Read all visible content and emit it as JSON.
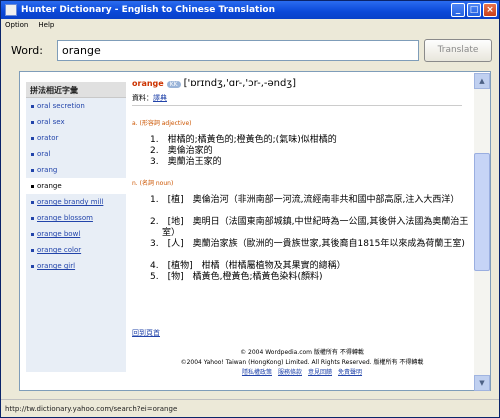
{
  "window": {
    "title": "Hunter Dictionary - English to Chinese Translation",
    "buttons": {
      "minimize": "_",
      "maximize": "□",
      "close": "×"
    }
  },
  "menu": [
    "Option",
    "Help"
  ],
  "search": {
    "label": "Word:",
    "value": "orange",
    "button": "Translate"
  },
  "sidebar": {
    "header": "拼法相近字彙",
    "items": [
      {
        "label": "oral secretion",
        "selected": false
      },
      {
        "label": "oral sex",
        "selected": false
      },
      {
        "label": "orator",
        "selected": false
      },
      {
        "label": "oral",
        "selected": false
      },
      {
        "label": "orang",
        "selected": false
      },
      {
        "label": "orange",
        "selected": true
      },
      {
        "label": "orange brandy mill",
        "selected": false
      },
      {
        "label": "orange blossom",
        "selected": false
      },
      {
        "label": "orange bowl",
        "selected": false
      },
      {
        "label": "orange color",
        "selected": false
      },
      {
        "label": "orange girl",
        "selected": false
      }
    ]
  },
  "entry": {
    "word": "orange",
    "badge": "KK",
    "ipa": "['ɒrɪndʒ,'ɑr-,'ɔr-,-əndʒ]",
    "source_label": "資料：",
    "source_link": "譯典",
    "adj_label": "a. (形容詞 adjective)",
    "adj_defs": [
      "1.　柑橘的;橘黃色的;橙黃色的;(氣味)似柑橘的",
      "2.　奧倫治家的",
      "3.　奧蘭治王家的"
    ],
    "noun_label": "n. (名詞 noun)",
    "noun_defs": [
      "1.　[植]　奧倫治河（非洲南部一河流,流經南非共和國中部高原,注入大西洋）",
      "2.　[地]　奧明日（法國東南部城鎮,中世紀時為一公國,其後併入法國為奧蘭治王室）",
      "3.　[人]　奧蘭治家族（歐洲的一貴族世家,其後裔自1815年以來成為荷蘭王室)",
      "4.　[植物]　柑橘（柑橘屬植物及其果實的總稱）",
      "5.　[物]　橘黃色,橙黃色;橘黃色染料(顏料)"
    ],
    "footer_link": "回到頁首"
  },
  "copyright": {
    "line1": "© 2004 Wordpedia.com 版權所有 不得轉載",
    "line2": "©2004 Yahoo! Taiwan (HongKong) Limited. All Rights Reserved. 版權所有 不得轉載",
    "links": [
      "隱私權政策",
      "服務條款",
      "意見回饋",
      "免責聲明"
    ]
  },
  "status": "http://tw.dictionary.yahoo.com/search?ei=orange"
}
